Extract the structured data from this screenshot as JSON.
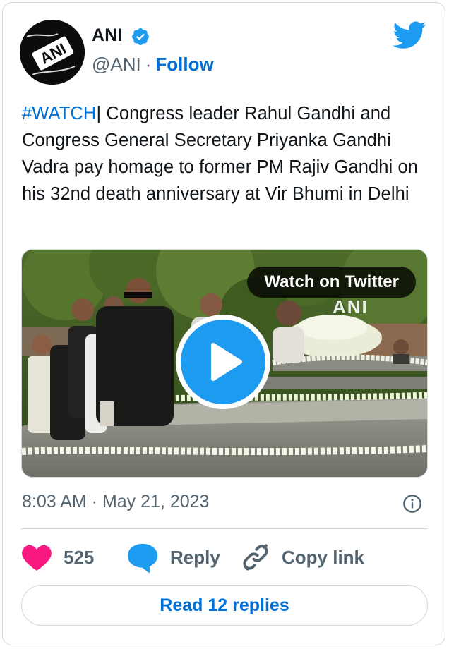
{
  "author": {
    "name": "ANI",
    "handle": "@ANI",
    "separator": "·",
    "follow_label": "Follow",
    "avatar_logo_text": "ANI"
  },
  "tweet": {
    "hashtag": "#WATCH",
    "text": "| Congress leader Rahul Gandhi and Congress General Secretary Priyanka Gandhi Vadra pay homage to former PM Rajiv Gandhi on his 32nd death anniversary at Vir Bhumi in Delhi"
  },
  "media": {
    "watch_label": "Watch on Twitter",
    "watermark": "ANI"
  },
  "meta": {
    "timestamp": "8:03 AM · May 21, 2023"
  },
  "actions": {
    "like_count": "525",
    "reply_label": "Reply",
    "copy_link_label": "Copy link"
  },
  "read_replies_label": "Read 12 replies",
  "colors": {
    "link_blue": "#006fd6",
    "twitter_blue": "#1d9bf0",
    "like_pink": "#f91880",
    "muted_gray": "#536471",
    "border": "#cfd9de"
  },
  "icons": [
    "verified-badge-icon",
    "twitter-bird-icon",
    "play-icon",
    "info-icon",
    "heart-icon",
    "speech-bubble-icon",
    "link-icon"
  ]
}
